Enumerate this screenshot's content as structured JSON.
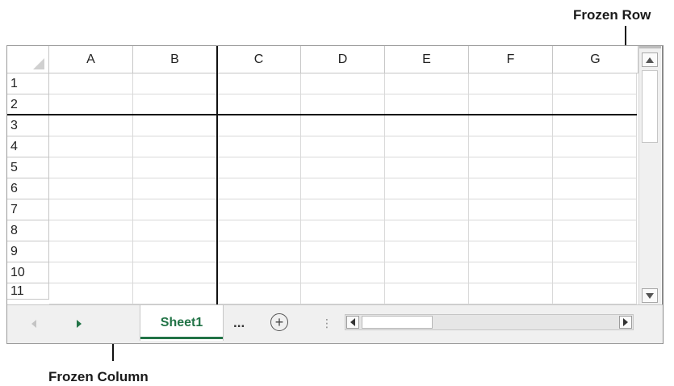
{
  "annotations": {
    "frozen_row": "Frozen Row",
    "frozen_column": "Frozen Column"
  },
  "columns": [
    "A",
    "B",
    "C",
    "D",
    "E",
    "F",
    "G"
  ],
  "rows": [
    "1",
    "2",
    "3",
    "4",
    "5",
    "6",
    "7",
    "8",
    "9",
    "10",
    "11"
  ],
  "sheet_tabs": {
    "active": "Sheet1",
    "more": "...",
    "add": "+"
  },
  "colors": {
    "accent": "#217346",
    "freeze_line": "#111111",
    "gridline": "#d9d9d9"
  },
  "icons": {
    "scroll_up": "scroll-up-arrow-icon",
    "scroll_down": "scroll-down-arrow-icon",
    "scroll_left": "scroll-left-arrow-icon",
    "scroll_right": "scroll-right-arrow-icon",
    "add_sheet": "add-sheet-plus-icon"
  }
}
